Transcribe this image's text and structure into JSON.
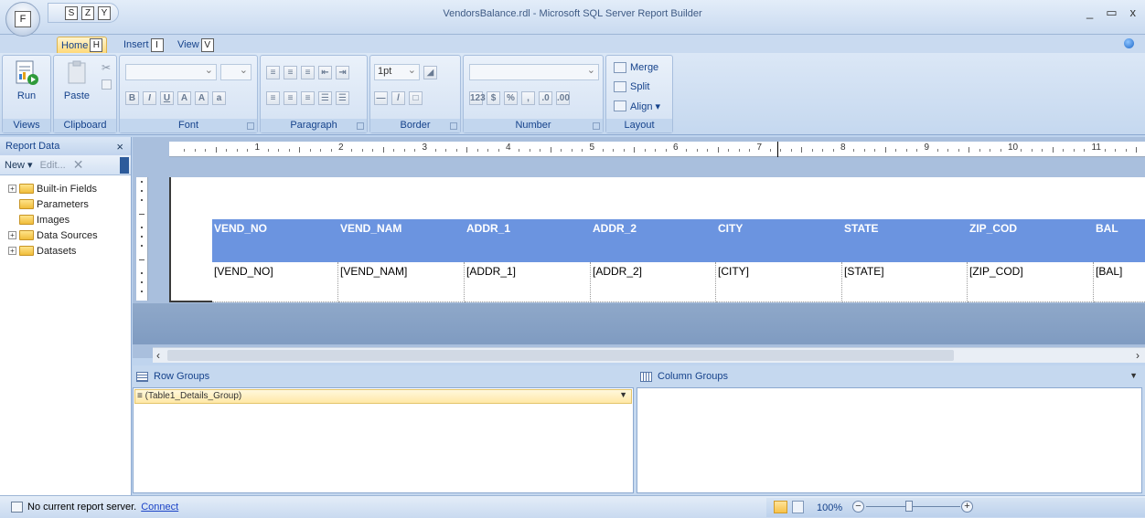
{
  "app": {
    "title": "VendorsBalance.rdl - Microsoft SQL Server Report Builder",
    "orb_keytip": "F",
    "qat_keytips": [
      "S",
      "Z",
      "Y"
    ],
    "window_controls": [
      "_",
      "▭",
      "x"
    ]
  },
  "tabs": [
    {
      "label": "Home",
      "keytip": "H",
      "active": true
    },
    {
      "label": "Insert",
      "keytip": "I",
      "active": false
    },
    {
      "label": "View",
      "keytip": "V",
      "active": false
    }
  ],
  "ribbon": {
    "groups": {
      "views": "Views",
      "clipboard": "Clipboard",
      "font": "Font",
      "paragraph": "Paragraph",
      "border": "Border",
      "number": "Number",
      "layout": "Layout"
    },
    "run_label": "Run",
    "paste_label": "Paste",
    "border_size": "1pt",
    "layout_items": [
      "Merge",
      "Split",
      "Align ▾"
    ]
  },
  "report_data": {
    "title": "Report Data",
    "close": "×",
    "new_label": "New ▾",
    "edit_label": "Edit...",
    "tree": [
      {
        "label": "Built-in Fields",
        "expandable": true
      },
      {
        "label": "Parameters",
        "expandable": false
      },
      {
        "label": "Images",
        "expandable": false
      },
      {
        "label": "Data Sources",
        "expandable": true
      },
      {
        "label": "Datasets",
        "expandable": true
      }
    ]
  },
  "ruler": {
    "numbers": [
      "1",
      "2",
      "3",
      "4",
      "5",
      "6",
      "7",
      "8",
      "9",
      "10",
      "11"
    ]
  },
  "table": {
    "headers": [
      "VEND_NO",
      "VEND_NAM",
      "ADDR_1",
      "ADDR_2",
      "CITY",
      "STATE",
      "ZIP_COD",
      "BAL"
    ],
    "fields": [
      "[VEND_NO]",
      "[VEND_NAM]",
      "[ADDR_1]",
      "[ADDR_2]",
      "[CITY]",
      "[STATE]",
      "[ZIP_COD]",
      "[BAL]"
    ],
    "header_color": "#6b94e0"
  },
  "groups": {
    "row_title": "Row Groups",
    "column_title": "Column Groups",
    "row_items": [
      "≡ (Table1_Details_Group)"
    ]
  },
  "status": {
    "server_text": "No current report server.",
    "connect_label": "Connect",
    "zoom": "100%"
  }
}
